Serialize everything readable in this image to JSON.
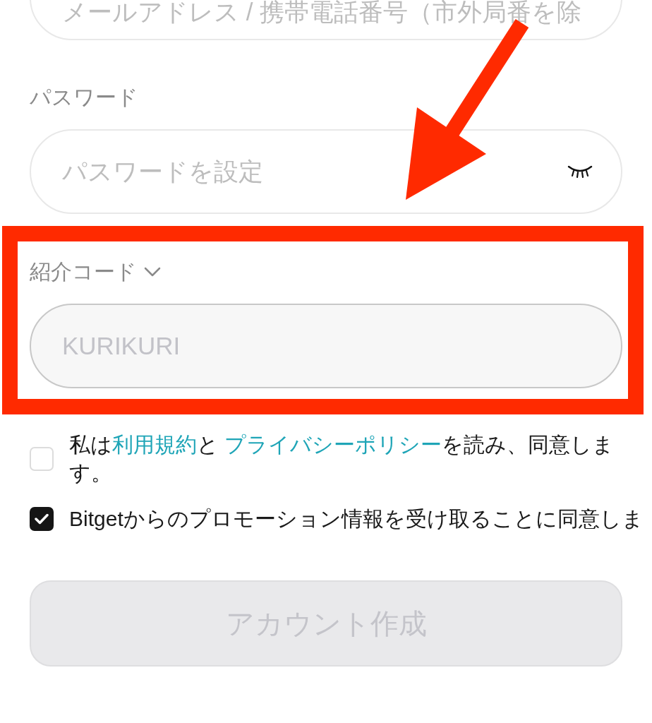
{
  "email_field": {
    "placeholder": "メールアドレス / 携帯電話番号（市外局番を除"
  },
  "password": {
    "label": "パスワード",
    "placeholder": "パスワードを設定",
    "visible": false
  },
  "referral": {
    "label": "紹介コード",
    "expanded": true,
    "value": "KURIKURI",
    "disabled": true
  },
  "agreements": [
    {
      "checked": false,
      "parts": [
        {
          "kind": "text",
          "text": "私は"
        },
        {
          "kind": "link",
          "text": "利用規約"
        },
        {
          "kind": "text",
          "text": "と "
        },
        {
          "kind": "link",
          "text": "プライバシーポリシー"
        },
        {
          "kind": "text",
          "text": "を読み、同意します。"
        }
      ]
    },
    {
      "checked": true,
      "parts": [
        {
          "kind": "text",
          "text": "Bitgetからのプロモーション情報を受け取ることに同意しま"
        }
      ]
    }
  ],
  "submit": {
    "label": "アカウント作成",
    "disabled": true
  }
}
